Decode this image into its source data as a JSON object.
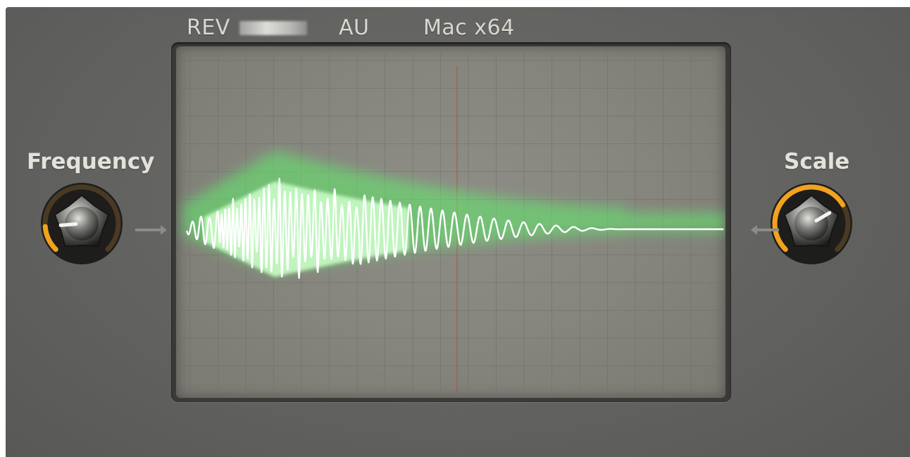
{
  "header": {
    "rev_label": "REV",
    "format_label": "AU",
    "platform_label": "Mac x64"
  },
  "knobs": {
    "frequency": {
      "label": "Frequency",
      "level": 0.15
    },
    "scale": {
      "label": "Scale",
      "level": 0.72
    }
  },
  "colors": {
    "panel": "#636361",
    "screen": "#86857e",
    "trace": "#ffffff",
    "glow": "#5df06a",
    "knob_arc": "#f2a21e",
    "center_line": "#b2574a"
  },
  "icons": {
    "frequency_arrow": "arrow-right-icon",
    "scale_arrow": "arrow-left-icon"
  }
}
